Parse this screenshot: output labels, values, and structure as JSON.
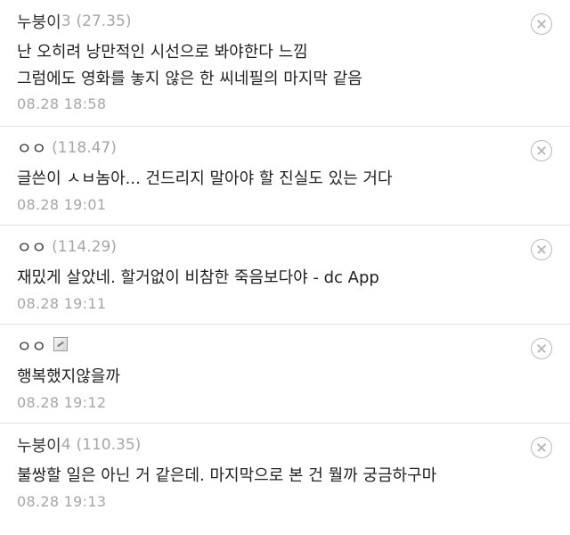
{
  "comments": [
    {
      "nick": "누붕이",
      "level": "3",
      "ip": "(27.35)",
      "lines": [
        "난 오히려 낭만적인 시선으로 봐야한다 느낌",
        "그럼에도 영화를 놓지 않은 한 씨네필의 마지막 같음"
      ],
      "date": "08.28 18:58",
      "delete_icon": "close-circle-icon"
    },
    {
      "nick": "ㅇㅇ",
      "ip": "(118.47)",
      "lines": [
        "글쓴이 ㅅㅂ놈아... 건드리지 말아야 할 진실도 있는 거다"
      ],
      "date": "08.28 19:01",
      "delete_icon": "close-circle-icon"
    },
    {
      "nick": "ㅇㅇ",
      "ip": "(114.29)",
      "lines": [
        "재밌게 살았네. 할거없이 비참한 죽음보다야 - dc App"
      ],
      "date": "08.28 19:11",
      "delete_icon": "close-circle-icon"
    },
    {
      "nick": "ㅇㅇ",
      "member_icon": "fixed-nick-icon",
      "lines": [
        "행복했지않을까"
      ],
      "date": "08.28 19:12",
      "delete_icon": "close-circle-icon"
    },
    {
      "nick": "누붕이",
      "level": "4",
      "ip": "(110.35)",
      "lines": [
        "불쌍할 일은 아닌 거 같은데. 마지막으로 본 건 뭘까 궁금하구마"
      ],
      "date": "08.28 19:13",
      "delete_icon": "close-circle-icon"
    }
  ]
}
